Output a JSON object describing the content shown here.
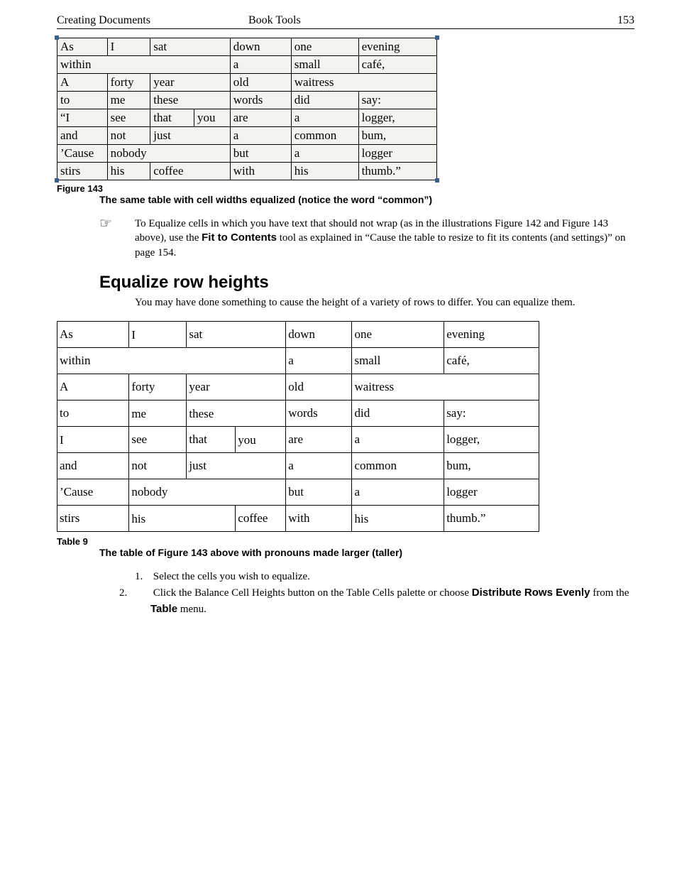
{
  "header": {
    "left": "Creating Documents",
    "center": "Book Tools",
    "right": "153"
  },
  "fig1": {
    "rows": [
      [
        "As",
        "I",
        "sat",
        "down",
        "one",
        "evening"
      ],
      [
        "within",
        "a",
        "small",
        "café,"
      ],
      [
        "A",
        "forty",
        "year",
        "old",
        "waitress"
      ],
      [
        "to",
        "me",
        "these",
        "words",
        "did",
        "say:"
      ],
      [
        "“I",
        "see",
        "that",
        "you",
        "are",
        "a",
        "logger,"
      ],
      [
        "and",
        "not",
        "just",
        "a",
        "common",
        "bum,"
      ],
      [
        "’Cause",
        "nobody",
        "but",
        "a",
        "logger"
      ],
      [
        "stirs",
        "his",
        "coffee",
        "with",
        "his",
        "thumb.”"
      ]
    ],
    "label": "Figure 143",
    "caption": "The same table with cell widths equalized (notice the word “common”)"
  },
  "note": {
    "body_a": "To Equalize cells in which you have text that should not wrap (as in the illustrations Figure 142 and Figure 143 above), use the ",
    "tool": "Fit to Contents",
    "body_b": " tool as explained in “Cause the table to resize to fit its contents (and settings)” on page 154."
  },
  "section": {
    "title": "Equalize row heights",
    "intro": "You may have done something to cause the height of a variety of rows to differ. You can equalize them."
  },
  "fig2": {
    "rows": [
      [
        "As",
        "I",
        "sat",
        "down",
        "one",
        "evening"
      ],
      [
        "within",
        "a",
        "small",
        "café,"
      ],
      [
        "A",
        "forty",
        "year",
        "old",
        "waitress"
      ],
      [
        "to",
        "me",
        "these",
        "words",
        "did",
        "say:"
      ],
      [
        "I",
        "see",
        "that",
        "you",
        "are",
        "a",
        "logger,"
      ],
      [
        "and",
        "not",
        "just",
        "a",
        "common",
        "bum,"
      ],
      [
        "’Cause",
        "nobody",
        "but",
        "a",
        "logger"
      ],
      [
        "stirs",
        "his",
        "coffee",
        "with",
        "his",
        "thumb.”"
      ]
    ],
    "label": "Table 9",
    "caption": "The table of Figure 143 above with pronouns made larger (taller)"
  },
  "steps": {
    "s1": "Select the cells you wish to equalize.",
    "s2a": "Click the Balance Cell Heights button on the Table Cells palette or choose ",
    "s2b": "Distribute Rows Evenly",
    "s2c": " from the ",
    "s2d": "Table",
    "s2e": " menu."
  }
}
